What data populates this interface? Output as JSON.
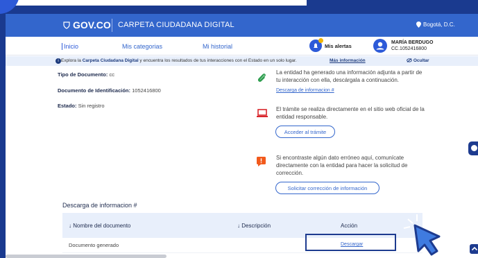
{
  "gov_bar": {
    "logo": "GOV.CO",
    "title": "CARPETA CIUDADANA DIGITAL",
    "location": "Bogotá, D.C."
  },
  "nav": {
    "items": [
      {
        "label": "Inicio"
      },
      {
        "label": "Mis categorias"
      },
      {
        "label": "Mi historial"
      }
    ],
    "alerts_label": "Mis alertas",
    "user_name": "MARÍA BERDUGO",
    "user_id": "CC.1052416800"
  },
  "banner": {
    "prefix": "Explora la ",
    "bold": "Carpeta Ciudadana Digital",
    "suffix": " y encuentra los resultados de tus interacciones con el Estado en un solo lugar.",
    "more_link": "Más información",
    "hide_label": "Ocultar"
  },
  "details": {
    "doc_type_label": "Tipo de Documento:",
    "doc_type_value": "cc",
    "doc_id_label": "Documento de Identificación:",
    "doc_id_value": "1052416800",
    "status_label": "Estado:",
    "status_value": "Sin registro"
  },
  "cards": {
    "attachment_text": "La entidad ha generado una información adjunta a partir de tu interacción con ella, descárgala a continuación.",
    "attachment_link": "Descarga de informacion #",
    "online_text": "El trámite se realiza directamente en el sitio web oficial de la entidad responsable.",
    "online_button": "Acceder al trámite",
    "error_text": "Si encontraste algún dato erróneo aquí, comunícate directamente con la entidad para hacer la solicitud de corrección.",
    "error_button": "Solicitar corrección de información"
  },
  "downloads": {
    "title": "Descarga de informacion #",
    "columns": [
      "↓ Nombre del documento",
      "↓ Descripción",
      "Acción"
    ],
    "rows": [
      {
        "name": "Documento generado",
        "description": "",
        "action": "Descargar"
      }
    ]
  },
  "colors": {
    "gov_blue": "#3366cc",
    "frame_blue": "#1a3a8f",
    "banner_bg": "#e8effb",
    "error_orange": "#f25a1c",
    "laptop_red": "#d9262c",
    "clip_green": "#2e9e4f"
  }
}
